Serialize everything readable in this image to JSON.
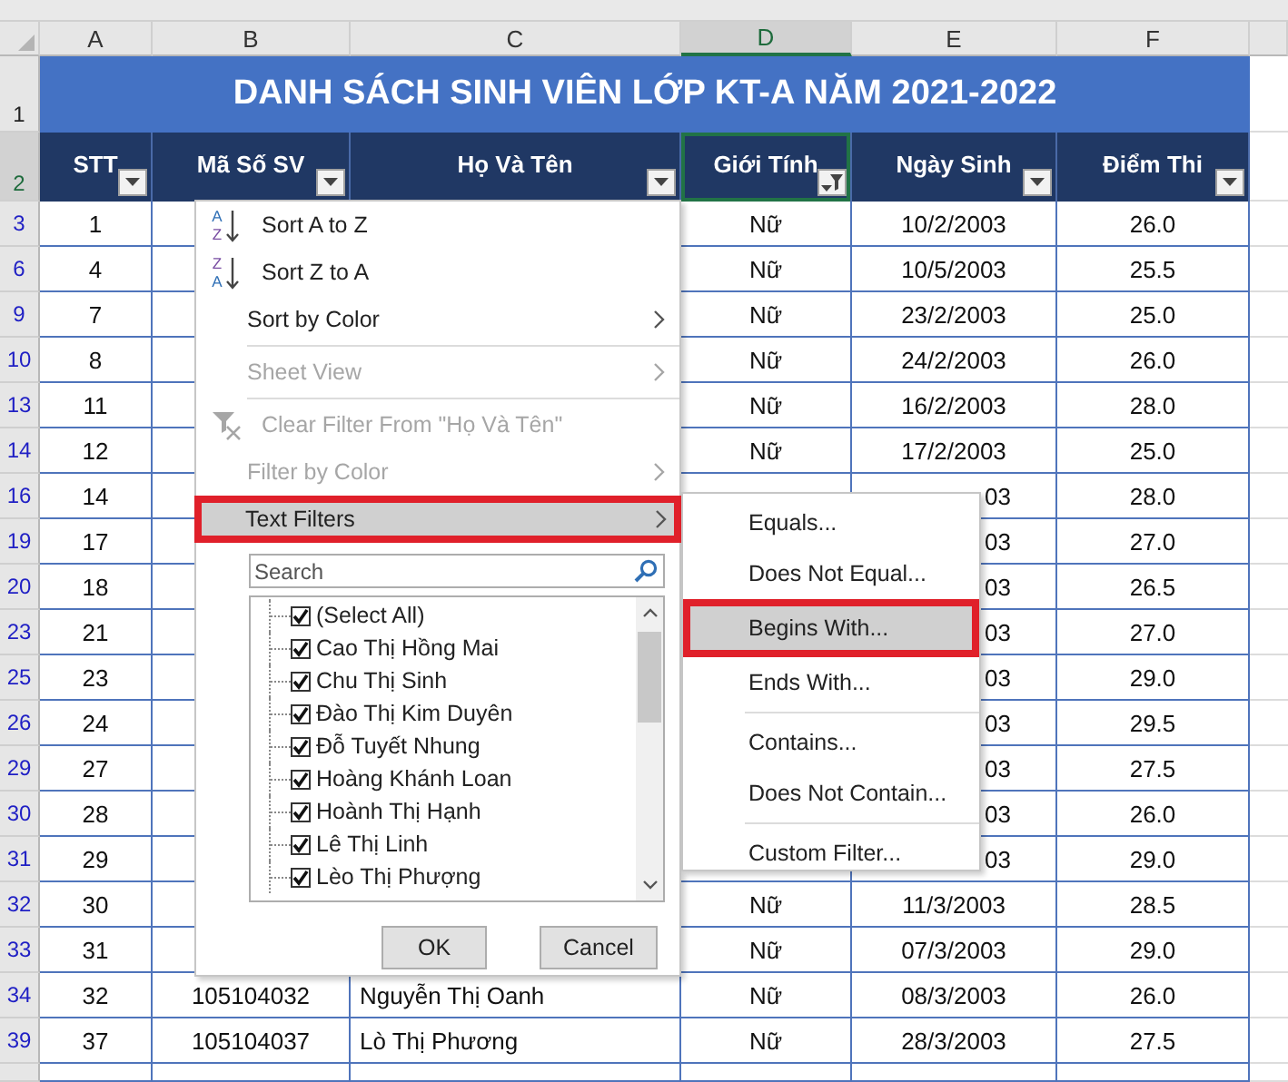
{
  "column_headers": [
    {
      "label": "A",
      "selected": false
    },
    {
      "label": "B",
      "selected": false
    },
    {
      "label": "C",
      "selected": false
    },
    {
      "label": "D",
      "selected": true
    },
    {
      "label": "E",
      "selected": false
    },
    {
      "label": "F",
      "selected": false
    }
  ],
  "title_row": {
    "row_number": "1",
    "title": "DANH SÁCH SINH VIÊN LỚP KT-A NĂM 2021-2022"
  },
  "header_row": {
    "row_number": "2",
    "cells": [
      {
        "label": "STT",
        "filtered": false,
        "selected": false
      },
      {
        "label": "Mã Số SV",
        "filtered": false,
        "selected": false
      },
      {
        "label": "Họ Và Tên",
        "filtered": false,
        "selected": false
      },
      {
        "label": "Giới Tính",
        "filtered": true,
        "selected": true
      },
      {
        "label": "Ngày Sinh",
        "filtered": false,
        "selected": false
      },
      {
        "label": "Điểm Thi",
        "filtered": false,
        "selected": false
      }
    ]
  },
  "rows": [
    {
      "row_number": "3",
      "stt": "1",
      "gender": "Nữ",
      "birth_date": "10/2/2003",
      "score": "26.0"
    },
    {
      "row_number": "6",
      "stt": "4",
      "gender": "Nữ",
      "birth_date": "10/5/2003",
      "score": "25.5"
    },
    {
      "row_number": "9",
      "stt": "7",
      "gender": "Nữ",
      "birth_date": "23/2/2003",
      "score": "25.0"
    },
    {
      "row_number": "10",
      "stt": "8",
      "gender": "Nữ",
      "birth_date": "24/2/2003",
      "score": "26.0"
    },
    {
      "row_number": "13",
      "stt": "11",
      "gender": "Nữ",
      "birth_date": "16/2/2003",
      "score": "28.0"
    },
    {
      "row_number": "14",
      "stt": "12",
      "gender": "Nữ",
      "birth_date": "17/2/2003",
      "score": "25.0"
    },
    {
      "row_number": "16",
      "stt": "14",
      "birth_date": "03",
      "birth_date_clipped": true,
      "score": "28.0"
    },
    {
      "row_number": "19",
      "stt": "17",
      "birth_date": "03",
      "birth_date_clipped": true,
      "score": "27.0"
    },
    {
      "row_number": "20",
      "stt": "18",
      "birth_date": "03",
      "birth_date_clipped": true,
      "score": "26.5"
    },
    {
      "row_number": "23",
      "stt": "21",
      "birth_date": "03",
      "birth_date_clipped": true,
      "score": "27.0"
    },
    {
      "row_number": "25",
      "stt": "23",
      "birth_date": "03",
      "birth_date_clipped": true,
      "score": "29.0"
    },
    {
      "row_number": "26",
      "stt": "24",
      "birth_date": "03",
      "birth_date_clipped": true,
      "score": "29.5"
    },
    {
      "row_number": "29",
      "stt": "27",
      "birth_date": "03",
      "birth_date_clipped": true,
      "score": "27.5"
    },
    {
      "row_number": "30",
      "stt": "28",
      "birth_date": "03",
      "birth_date_clipped": true,
      "score": "26.0"
    },
    {
      "row_number": "31",
      "stt": "29",
      "birth_date": "03",
      "birth_date_clipped": true,
      "score": "29.0"
    },
    {
      "row_number": "32",
      "stt": "30",
      "gender": "Nữ",
      "birth_date": "11/3/2003",
      "score": "28.5"
    },
    {
      "row_number": "33",
      "stt": "31",
      "gender": "Nữ",
      "birth_date": "07/3/2003",
      "score": "29.0"
    },
    {
      "row_number": "34",
      "stt": "32",
      "student_id": "105104032",
      "full_name": "Nguyễn Thị Oanh",
      "gender": "Nữ",
      "birth_date": "08/3/2003",
      "score": "26.0"
    },
    {
      "row_number": "39",
      "stt": "37",
      "student_id": "105104037",
      "full_name": "Lò Thị Phương",
      "gender": "Nữ",
      "birth_date": "28/3/2003",
      "score": "27.5"
    }
  ],
  "filter_menu": {
    "items": [
      {
        "kind": "sort_ascending",
        "label": "Sort A to Z",
        "icon_letters": [
          "A",
          "Z"
        ],
        "disabled": false,
        "highlighted": false
      },
      {
        "kind": "sort_descending",
        "label": "Sort Z to A",
        "icon_letters": [
          "Z",
          "A"
        ],
        "disabled": false,
        "highlighted": false
      },
      {
        "kind": "submenu",
        "label": "Sort by Color",
        "disabled": false,
        "highlighted": false
      },
      {
        "kind": "separator"
      },
      {
        "kind": "submenu",
        "label": "Sheet View",
        "disabled": true,
        "highlighted": false
      },
      {
        "kind": "separator"
      },
      {
        "kind": "clear_filter",
        "label": "Clear Filter From \"Họ Và Tên\"",
        "disabled": true,
        "highlighted": false
      },
      {
        "kind": "submenu",
        "label": "Filter by Color",
        "disabled": true,
        "highlighted": false
      },
      {
        "kind": "submenu",
        "label": "Text Filters",
        "disabled": false,
        "highlighted": true
      }
    ],
    "search": {
      "placeholder": "Search"
    },
    "values": [
      {
        "label": "(Select All)",
        "checked": true
      },
      {
        "label": "Cao Thị Hồng Mai",
        "checked": true
      },
      {
        "label": "Chu Thị Sinh",
        "checked": true
      },
      {
        "label": "Đào Thị Kim Duyên",
        "checked": true
      },
      {
        "label": "Đỗ Tuyết Nhung",
        "checked": true
      },
      {
        "label": "Hoàng Khánh Loan",
        "checked": true
      },
      {
        "label": "Hoành Thị Hạnh",
        "checked": true
      },
      {
        "label": "Lê Thị Linh",
        "checked": true
      },
      {
        "label": "Lèo Thị Phượng",
        "checked": true
      }
    ],
    "buttons": [
      "OK",
      "Cancel"
    ]
  },
  "text_filters_menu": {
    "items": [
      {
        "kind": "command",
        "label": "Equals...",
        "highlighted": false
      },
      {
        "kind": "command",
        "label": "Does Not Equal...",
        "highlighted": false
      },
      {
        "kind": "command",
        "label": "Begins With...",
        "highlighted": true
      },
      {
        "kind": "command",
        "label": "Ends With...",
        "highlighted": false
      },
      {
        "kind": "separator"
      },
      {
        "kind": "command",
        "label": "Contains...",
        "highlighted": false
      },
      {
        "kind": "command",
        "label": "Does Not Contain...",
        "highlighted": false
      },
      {
        "kind": "separator"
      },
      {
        "kind": "command",
        "label": "Custom Filter...",
        "highlighted": false
      }
    ]
  }
}
